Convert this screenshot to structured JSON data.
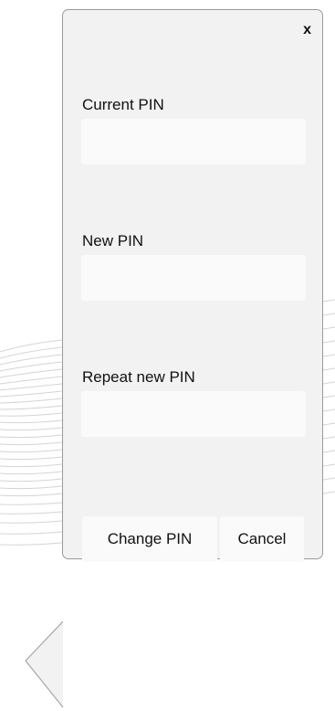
{
  "dialog": {
    "close_label": "x",
    "fields": [
      {
        "label": "Current PIN",
        "value": "",
        "placeholder": ""
      },
      {
        "label": "New PIN",
        "value": "",
        "placeholder": ""
      },
      {
        "label": "Repeat new PIN",
        "value": "",
        "placeholder": ""
      }
    ],
    "buttons": {
      "change_label": "Change PIN",
      "cancel_label": "Cancel"
    }
  },
  "colors": {
    "panel_background": "#f2f2f2",
    "input_background": "#fafafa",
    "panel_border": "#9a9a9a"
  }
}
